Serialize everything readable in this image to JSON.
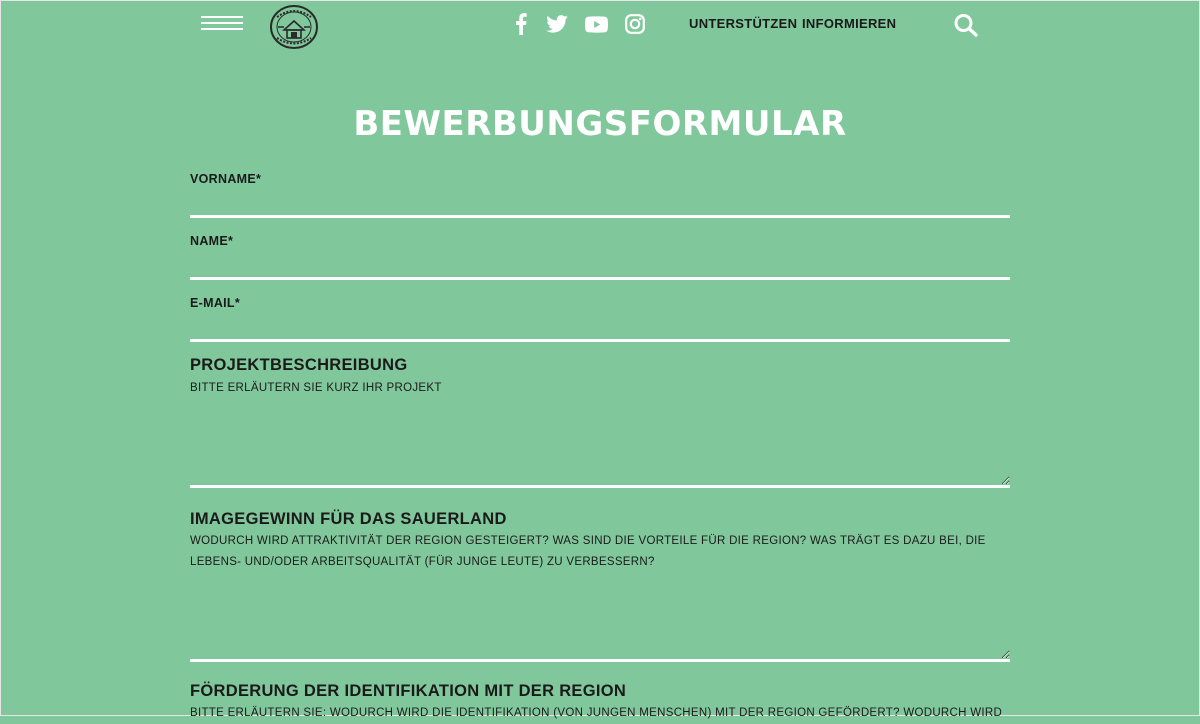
{
  "header": {
    "logo_alt": "Logo",
    "social": [
      {
        "icon": "facebook-icon"
      },
      {
        "icon": "twitter-icon"
      },
      {
        "icon": "youtube-icon"
      },
      {
        "icon": "instagram-icon"
      }
    ],
    "nav": {
      "support_label": "UNTERSTÜTZEN",
      "inform_label": "INFORMIEREN"
    }
  },
  "page": {
    "title": "BEWERBUNGSFORMULAR"
  },
  "form": {
    "firstname": {
      "label": "VORNAME*",
      "value": ""
    },
    "name": {
      "label": "NAME*",
      "value": ""
    },
    "email": {
      "label": "E-MAIL*",
      "value": ""
    },
    "project": {
      "heading": "PROJEKTBESCHREIBUNG",
      "hint": "BITTE ERLÄUTERN SIE KURZ IHR PROJEKT",
      "value": ""
    },
    "image": {
      "heading": "IMAGEGEWINN FÜR DAS SAUERLAND",
      "hint": "WODURCH WIRD ATTRAKTIVITÄT DER REGION GESTEIGERT? WAS SIND DIE VORTEILE FÜR DIE REGION? WAS TRÄGT ES DAZU BEI, DIE LEBENS- UND/ODER ARBEITSQUALITÄT (FÜR JUNGE LEUTE) ZU VERBESSERN?",
      "value": ""
    },
    "identification": {
      "heading": "FÖRDERUNG DER IDENTIFIKATION MIT DER REGION",
      "hint": "BITTE ERLÄUTERN SIE: WODURCH WIRD DIE IDENTIFIKATION (VON JUNGEN MENSCHEN) MIT DER REGION GEFÖRDERT? WODURCH WIRD"
    }
  },
  "colors": {
    "background": "#80c89b",
    "text": "#1a1a1a",
    "accent": "#ffffff"
  }
}
